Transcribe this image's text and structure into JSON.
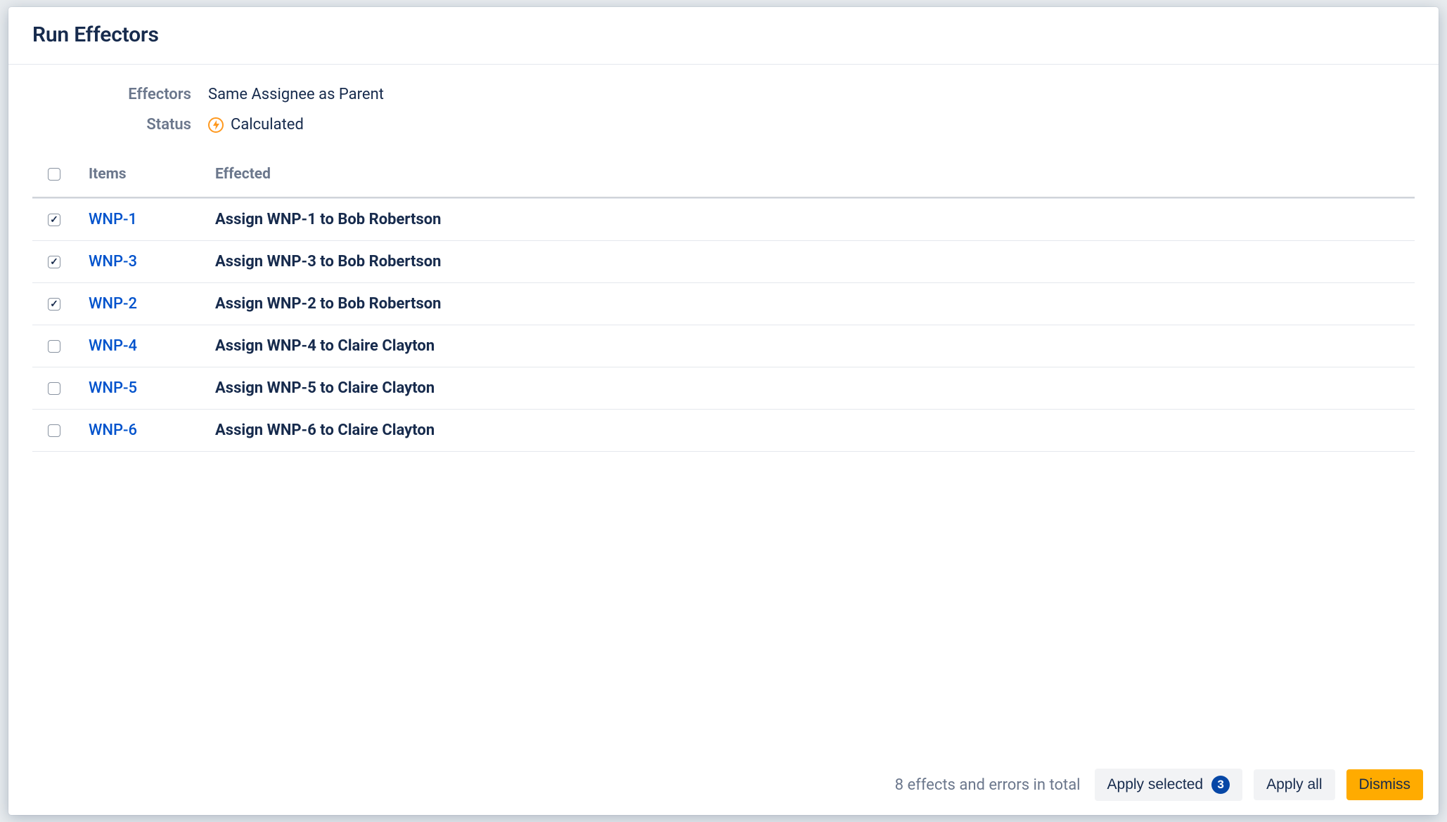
{
  "dialog": {
    "title": "Run Effectors",
    "meta": {
      "effectors_label": "Effectors",
      "effectors_value": "Same Assignee as Parent",
      "status_label": "Status",
      "status_value": "Calculated"
    },
    "columns": {
      "items": "Items",
      "effected": "Effected"
    },
    "rows": [
      {
        "checked": true,
        "item": "WNP-1",
        "action": "Assign",
        "target": "WNP-1",
        "to": "to",
        "assignee": "Bob Robertson"
      },
      {
        "checked": true,
        "item": "WNP-3",
        "action": "Assign",
        "target": "WNP-3",
        "to": "to",
        "assignee": "Bob Robertson"
      },
      {
        "checked": true,
        "item": "WNP-2",
        "action": "Assign",
        "target": "WNP-2",
        "to": "to",
        "assignee": "Bob Robertson"
      },
      {
        "checked": false,
        "item": "WNP-4",
        "action": "Assign",
        "target": "WNP-4",
        "to": "to",
        "assignee": "Claire Clayton"
      },
      {
        "checked": false,
        "item": "WNP-5",
        "action": "Assign",
        "target": "WNP-5",
        "to": "to",
        "assignee": "Claire Clayton"
      },
      {
        "checked": false,
        "item": "WNP-6",
        "action": "Assign",
        "target": "WNP-6",
        "to": "to",
        "assignee": "Claire Clayton"
      }
    ],
    "footer": {
      "summary": "8 effects and errors in total",
      "apply_selected": "Apply selected",
      "selected_count": "3",
      "apply_all": "Apply all",
      "dismiss": "Dismiss"
    }
  }
}
